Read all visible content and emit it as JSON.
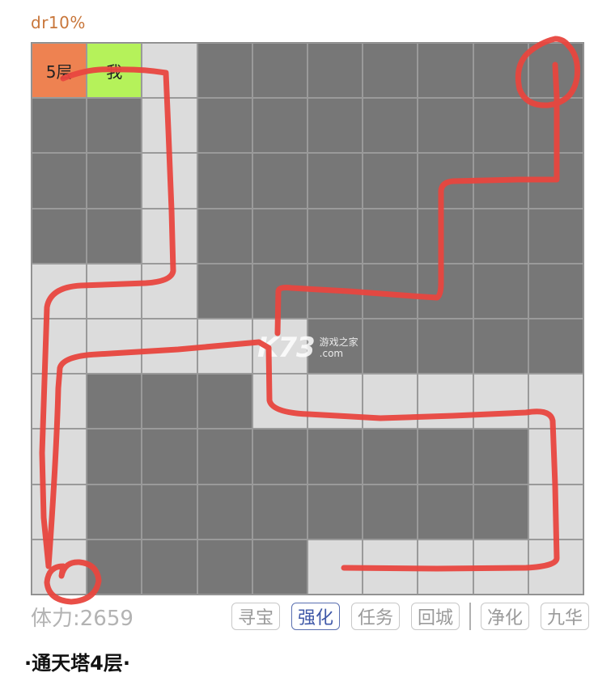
{
  "header": {
    "dr": "dr10%"
  },
  "grid": {
    "rows": [
      [
        "floor",
        "me",
        "open",
        "wall",
        "wall",
        "wall",
        "wall",
        "wall",
        "wall",
        "wall"
      ],
      [
        "wall",
        "wall",
        "open",
        "wall",
        "wall",
        "wall",
        "wall",
        "wall",
        "wall",
        "wall"
      ],
      [
        "wall",
        "wall",
        "open",
        "wall",
        "wall",
        "wall",
        "wall",
        "wall",
        "wall",
        "wall"
      ],
      [
        "wall",
        "wall",
        "open",
        "wall",
        "wall",
        "wall",
        "wall",
        "wall",
        "wall",
        "wall"
      ],
      [
        "open",
        "open",
        "open",
        "wall",
        "wall",
        "wall",
        "wall",
        "wall",
        "wall",
        "wall"
      ],
      [
        "open",
        "open",
        "open",
        "open",
        "open",
        "wall",
        "wall",
        "wall",
        "wall",
        "wall"
      ],
      [
        "open",
        "wall",
        "wall",
        "wall",
        "open",
        "open",
        "open",
        "open",
        "open",
        "open"
      ],
      [
        "open",
        "wall",
        "wall",
        "wall",
        "wall",
        "wall",
        "wall",
        "wall",
        "wall",
        "open"
      ],
      [
        "open",
        "wall",
        "wall",
        "wall",
        "wall",
        "wall",
        "wall",
        "wall",
        "wall",
        "open"
      ],
      [
        "open",
        "wall",
        "wall",
        "wall",
        "wall",
        "open",
        "open",
        "open",
        "open",
        "open"
      ]
    ],
    "labels": {
      "floor": "5层",
      "player": "我"
    }
  },
  "watermark": {
    "logo": "K73",
    "line1": "游戏之家",
    "line2": ".com"
  },
  "status": {
    "stamina": "体力:2659"
  },
  "actions": [
    {
      "label": "寻宝",
      "active": false
    },
    {
      "label": "强化",
      "active": true
    },
    {
      "label": "任务",
      "active": false
    },
    {
      "label": "回城",
      "active": false
    },
    {
      "label": "净化",
      "active": false
    },
    {
      "label": "九华",
      "active": false
    }
  ],
  "title": "·通天塔4层·",
  "colors": {
    "wall": "#777777",
    "open": "#dcdcdc",
    "floor_tile": "#ee8251",
    "player_tile": "#b5f25a",
    "path_stroke": "#e8463f",
    "accent": "#3f58a8"
  }
}
